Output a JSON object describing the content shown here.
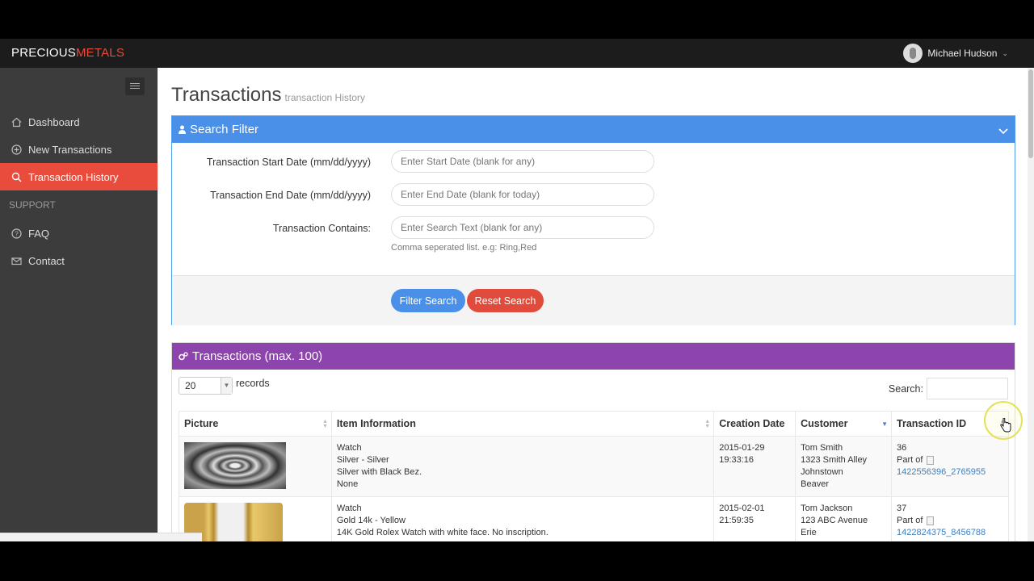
{
  "brand": {
    "part1": "PRECIOUS",
    "part2": "METALS"
  },
  "user": {
    "name": "Michael Hudson"
  },
  "sidebar": {
    "items": [
      {
        "label": "Dashboard",
        "icon": "home-icon"
      },
      {
        "label": "New Transactions",
        "icon": "plus-circle-icon"
      },
      {
        "label": "Transaction History",
        "icon": "search-icon",
        "active": true
      }
    ],
    "support_heading": "SUPPORT",
    "support_items": [
      {
        "label": "FAQ",
        "icon": "question-circle-icon"
      },
      {
        "label": "Contact",
        "icon": "envelope-icon"
      }
    ]
  },
  "page": {
    "title": "Transactions",
    "subtitle": "transaction History"
  },
  "filter": {
    "heading": "Search Filter",
    "start_label": "Transaction Start Date (mm/dd/yyyy)",
    "start_placeholder": "Enter Start Date (blank for any)",
    "end_label": "Transaction End Date (mm/dd/yyyy)",
    "end_placeholder": "Enter End Date (blank for today)",
    "contains_label": "Transaction Contains:",
    "contains_placeholder": "Enter Search Text (blank for any)",
    "help": "Comma seperated list. e.g: Ring,Red",
    "filter_button": "Filter Search",
    "reset_button": "Reset Search"
  },
  "transactions": {
    "heading": "Transactions (max. 100)",
    "page_size": "20",
    "records_label": "records",
    "search_label": "Search:",
    "columns": [
      "Picture",
      "Item Information",
      "Creation Date",
      "Customer",
      "Transaction ID"
    ],
    "rows": [
      {
        "item": [
          "Watch",
          "Silver - Silver",
          "Silver with Black Bez.",
          "None"
        ],
        "date": [
          "2015-01-29",
          "19:33:16"
        ],
        "customer": [
          "Tom Smith",
          "1323 Smith Alley",
          "Johnstown",
          "Beaver"
        ],
        "id": "36",
        "part_of": "Part of",
        "link": "1422556396_2765955"
      },
      {
        "item": [
          "Watch",
          "Gold 14k - Yellow",
          "14K Gold Rolex Watch with white face. No inscription."
        ],
        "date": [
          "2015-02-01",
          "21:59:35"
        ],
        "customer": [
          "Tom Jackson",
          "123 ABC Avenue",
          "Erie"
        ],
        "id": "37",
        "part_of": "Part of",
        "link": "1422824375_8456788"
      }
    ]
  },
  "colors": {
    "accent_red": "#e94b3c",
    "blue": "#4a90e9",
    "purple": "#8e44ad"
  }
}
